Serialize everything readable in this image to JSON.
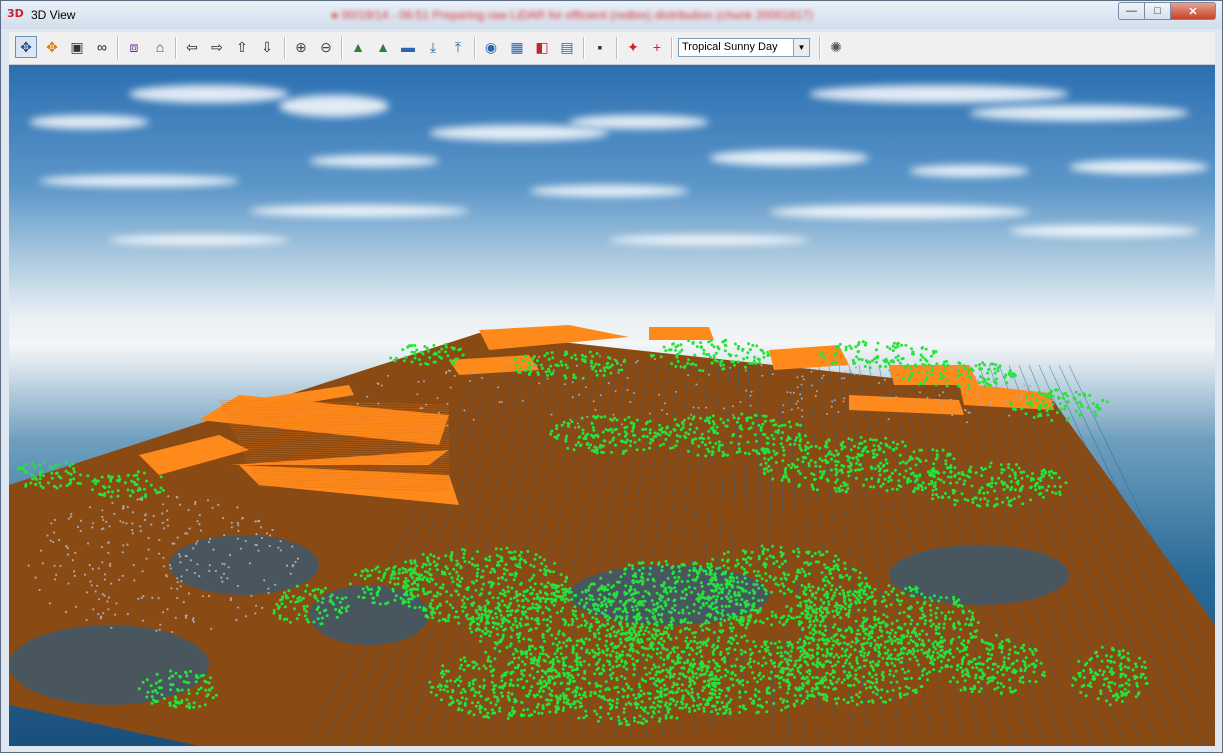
{
  "window": {
    "title": "3D View",
    "app_icon_text": "3D",
    "status_obscured": "● 00/19/14 - 06:51 Preparing raw LiDAR for efficient (redtex) distribution (chunk 20001817)",
    "controls": {
      "minimize": "—",
      "maximize": "□",
      "close": "✕"
    }
  },
  "toolbar": {
    "tools": [
      {
        "name": "pan-tool",
        "icon": "✥",
        "color": "#2a4d8a",
        "pressed": true
      },
      {
        "name": "move-tool",
        "icon": "✥",
        "color": "#d67b12"
      },
      {
        "name": "layers-tool",
        "icon": "▣",
        "color": "#333"
      },
      {
        "name": "binoculars-tool",
        "icon": "∞",
        "color": "#222"
      },
      {
        "name": "box-tool",
        "icon": "⧈",
        "color": "#6a2a8a"
      },
      {
        "name": "home-tool",
        "icon": "⌂",
        "color": "#1d4ea0"
      },
      {
        "name": "arrow-left",
        "icon": "⇦",
        "color": "#222"
      },
      {
        "name": "arrow-right",
        "icon": "⇨",
        "color": "#222"
      },
      {
        "name": "arrow-up",
        "icon": "⇧",
        "color": "#222"
      },
      {
        "name": "arrow-down",
        "icon": "⇩",
        "color": "#222"
      },
      {
        "name": "zoom-in",
        "icon": "⊕",
        "color": "#444"
      },
      {
        "name": "zoom-out",
        "icon": "⊖",
        "color": "#444"
      },
      {
        "name": "terrain-view-1",
        "icon": "▲",
        "color": "#2f7d3a"
      },
      {
        "name": "terrain-view-2",
        "icon": "▲",
        "color": "#2f7d3a"
      },
      {
        "name": "water-level",
        "icon": "▬",
        "color": "#2a66b0"
      },
      {
        "name": "lower-level",
        "icon": "⤓",
        "color": "#2a66b0"
      },
      {
        "name": "raise-level",
        "icon": "⤒",
        "color": "#2a66b0"
      },
      {
        "name": "camera-tool",
        "icon": "◉",
        "color": "#2a66b0"
      },
      {
        "name": "movie-tool",
        "icon": "▦",
        "color": "#2a66b0"
      },
      {
        "name": "record-tool",
        "icon": "◧",
        "color": "#c2262a"
      },
      {
        "name": "clapper-tool",
        "icon": "▤",
        "color": "#2a66b0"
      },
      {
        "name": "save-tool",
        "icon": "▪",
        "color": "#333"
      },
      {
        "name": "crosshair-red",
        "icon": "✦",
        "color": "#d81e1e"
      },
      {
        "name": "crosshair-thin",
        "icon": "+",
        "color": "#d81e1e"
      },
      {
        "name": "settings-tool",
        "icon": "✺",
        "color": "#555"
      }
    ],
    "sky_preset": "Tropical Sunny Day"
  },
  "scene": {
    "colors": {
      "ground": "#8a4a14",
      "building": "#ff8a1c",
      "vegetation": "#27e23d",
      "unclassified": "#a8a8b0",
      "water": "#1f5f90"
    }
  }
}
